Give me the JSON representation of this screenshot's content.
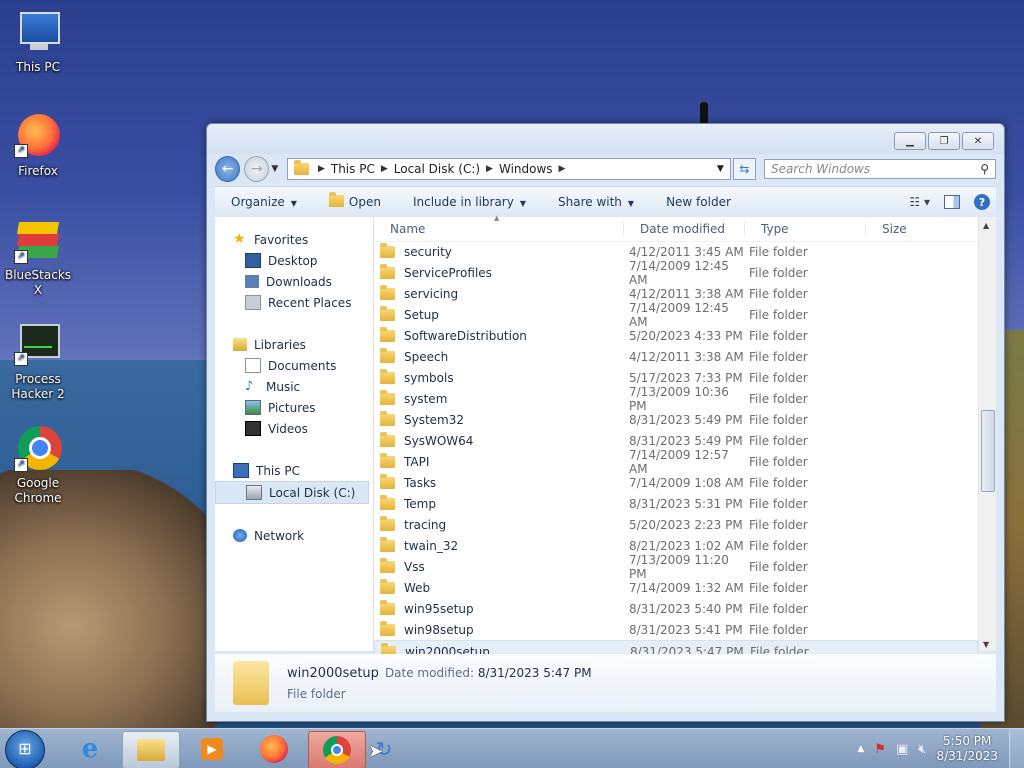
{
  "desktop": {
    "icons": [
      {
        "label": "This PC"
      },
      {
        "label": "Firefox"
      },
      {
        "label": "BlueStacks X"
      },
      {
        "label": "Process Hacker 2"
      },
      {
        "label": "Google Chrome"
      }
    ]
  },
  "window": {
    "breadcrumb": [
      "This PC",
      "Local Disk (C:)",
      "Windows"
    ],
    "search_placeholder": "Search Windows",
    "toolbar": {
      "organize": "Organize",
      "open": "Open",
      "include": "Include in library",
      "share": "Share with",
      "new_folder": "New folder"
    },
    "nav": {
      "favorites": "Favorites",
      "desktop": "Desktop",
      "downloads": "Downloads",
      "recent": "Recent Places",
      "libraries": "Libraries",
      "documents": "Documents",
      "music": "Music",
      "pictures": "Pictures",
      "videos": "Videos",
      "thispc": "This PC",
      "localdisk": "Local Disk (C:)",
      "network": "Network"
    },
    "columns": {
      "name": "Name",
      "date": "Date modified",
      "type": "Type",
      "size": "Size"
    },
    "files": [
      {
        "name": "security",
        "date": "4/12/2011 3:45 AM",
        "type": "File folder"
      },
      {
        "name": "ServiceProfiles",
        "date": "7/14/2009 12:45 AM",
        "type": "File folder"
      },
      {
        "name": "servicing",
        "date": "4/12/2011 3:38 AM",
        "type": "File folder"
      },
      {
        "name": "Setup",
        "date": "7/14/2009 12:45 AM",
        "type": "File folder"
      },
      {
        "name": "SoftwareDistribution",
        "date": "5/20/2023 4:33 PM",
        "type": "File folder"
      },
      {
        "name": "Speech",
        "date": "4/12/2011 3:38 AM",
        "type": "File folder"
      },
      {
        "name": "symbols",
        "date": "5/17/2023 7:33 PM",
        "type": "File folder"
      },
      {
        "name": "system",
        "date": "7/13/2009 10:36 PM",
        "type": "File folder"
      },
      {
        "name": "System32",
        "date": "8/31/2023 5:49 PM",
        "type": "File folder"
      },
      {
        "name": "SysWOW64",
        "date": "8/31/2023 5:49 PM",
        "type": "File folder"
      },
      {
        "name": "TAPI",
        "date": "7/14/2009 12:57 AM",
        "type": "File folder"
      },
      {
        "name": "Tasks",
        "date": "7/14/2009 1:08 AM",
        "type": "File folder"
      },
      {
        "name": "Temp",
        "date": "8/31/2023 5:31 PM",
        "type": "File folder"
      },
      {
        "name": "tracing",
        "date": "5/20/2023 2:23 PM",
        "type": "File folder"
      },
      {
        "name": "twain_32",
        "date": "8/21/2023 1:02 AM",
        "type": "File folder"
      },
      {
        "name": "Vss",
        "date": "7/13/2009 11:20 PM",
        "type": "File folder"
      },
      {
        "name": "Web",
        "date": "7/14/2009 1:32 AM",
        "type": "File folder"
      },
      {
        "name": "win95setup",
        "date": "8/31/2023 5:40 PM",
        "type": "File folder"
      },
      {
        "name": "win98setup",
        "date": "8/31/2023 5:41 PM",
        "type": "File folder"
      },
      {
        "name": "win2000setup",
        "date": "8/31/2023 5:47 PM",
        "type": "File folder"
      }
    ],
    "details": {
      "name": "win2000setup",
      "date_label": "Date modified:",
      "date": "8/31/2023 5:47 PM",
      "type": "File folder"
    }
  },
  "taskbar": {
    "time": "5:50 PM",
    "date": "8/31/2023"
  }
}
